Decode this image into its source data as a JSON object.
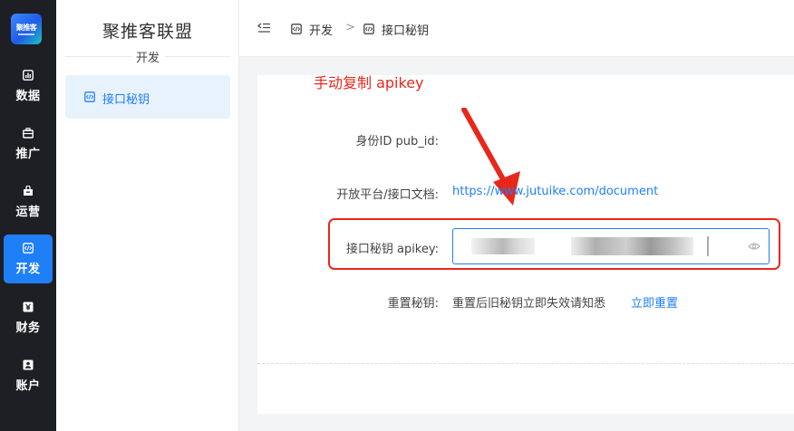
{
  "brand": {
    "logo_text": "聚推客"
  },
  "rail": {
    "items": [
      {
        "label": "数据",
        "icon": "chart-icon",
        "active": false
      },
      {
        "label": "推广",
        "icon": "briefcase-icon",
        "active": false
      },
      {
        "label": "运营",
        "icon": "bag-icon",
        "active": false
      },
      {
        "label": "开发",
        "icon": "code-icon",
        "active": true
      },
      {
        "label": "财务",
        "icon": "yen-icon",
        "active": false
      },
      {
        "label": "账户",
        "icon": "user-icon",
        "active": false
      }
    ]
  },
  "sidebar": {
    "title": "聚推客联盟",
    "section": "开发",
    "items": [
      {
        "label": "接口秘钥",
        "icon": "code-icon",
        "active": true
      }
    ]
  },
  "breadcrumb": {
    "items": [
      "开发",
      "接口秘钥"
    ],
    "separator": ">"
  },
  "annotation": "手动复制 apikey",
  "form": {
    "pub_id_label": "身份ID pub_id:",
    "doc_label": "开放平台/接口文档:",
    "doc_link": "https://www.jutuike.com/document",
    "apikey_label": "接口秘钥 apikey:",
    "reset_label": "重置秘钥:",
    "reset_hint": "重置后旧秘钥立即失效请知悉",
    "reset_button": "立即重置"
  },
  "colors": {
    "accent": "#1f7ff7",
    "annotation": "#e8271c",
    "rail_bg": "#1d1f24"
  }
}
